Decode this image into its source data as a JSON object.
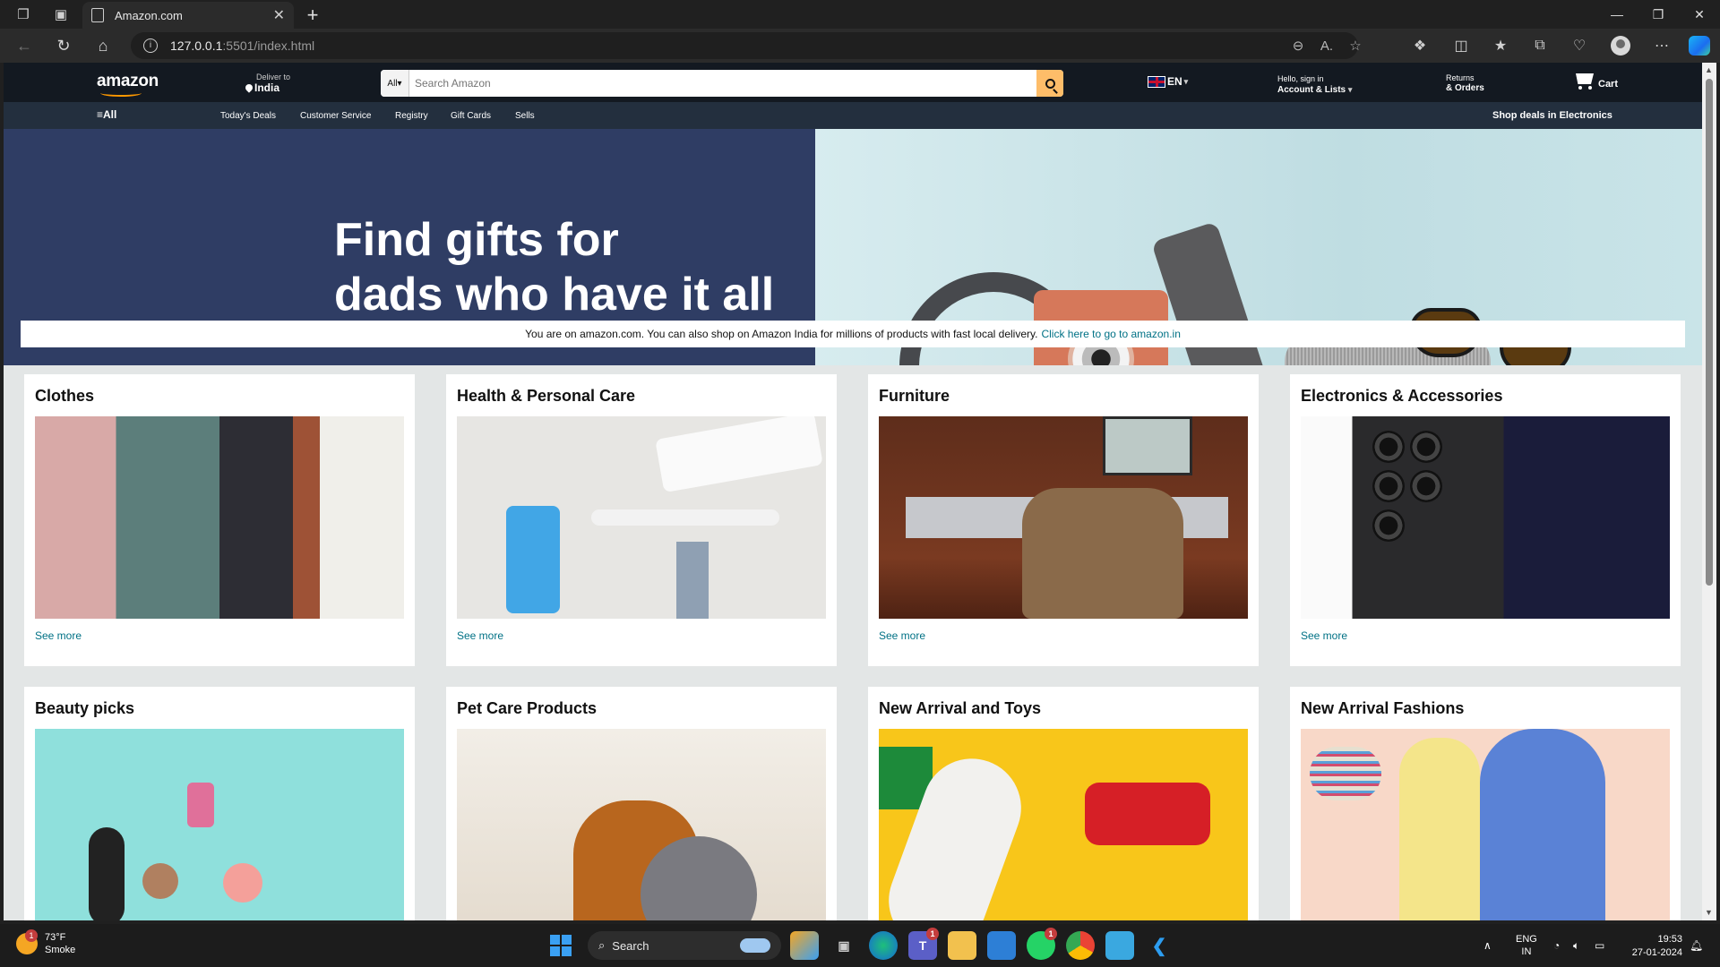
{
  "browser": {
    "tab_title": "Amazon.com",
    "url_host": "127.0.0.1",
    "url_path": ":5501/index.html"
  },
  "header": {
    "logo": "amazon",
    "deliver_label": "Deliver to",
    "deliver_location": "India",
    "search_category": "All",
    "search_placeholder": "Search Amazon",
    "language": "EN",
    "account_greeting": "Hello, sign in",
    "account_label": "Account & Lists",
    "returns_label": "Returns",
    "orders_label": "& Orders",
    "cart_label": "Cart"
  },
  "subnav": {
    "all_label": "All",
    "links": [
      "Today's Deals",
      "Customer Service",
      "Registry",
      "Gift Cards",
      "Sells"
    ],
    "deal_label": "Shop deals in Electronics"
  },
  "hero": {
    "title_line1": "Find gifts for",
    "title_line2": "dads who have it all"
  },
  "notice": {
    "text": "You are on amazon.com. You can also shop on Amazon India for millions of products with fast local delivery.",
    "link": "Click here to go to amazon.in"
  },
  "cards": [
    {
      "title": "Clothes",
      "link": "See more"
    },
    {
      "title": "Health & Personal Care",
      "link": "See more"
    },
    {
      "title": "Furniture",
      "link": "See more"
    },
    {
      "title": "Electronics & Accessories",
      "link": "See more"
    },
    {
      "title": "Beauty picks"
    },
    {
      "title": "Pet Care Products"
    },
    {
      "title": "New Arrival and Toys"
    },
    {
      "title": "New Arrival Fashions"
    }
  ],
  "taskbar": {
    "temperature": "73°F",
    "condition": "Smoke",
    "weather_badge": "1",
    "search_label": "Search",
    "teams_badge": "1",
    "whatsapp_badge": "1",
    "lang_line1": "ENG",
    "lang_line2": "IN",
    "time": "19:53",
    "date": "27-01-2024"
  },
  "colors": {
    "amazon_header": "#131921",
    "amazon_subnav": "#232f3e",
    "amazon_orange": "#ff9900",
    "search_button": "#febd69",
    "link": "#007185",
    "hero_left": "#2f3d64"
  }
}
